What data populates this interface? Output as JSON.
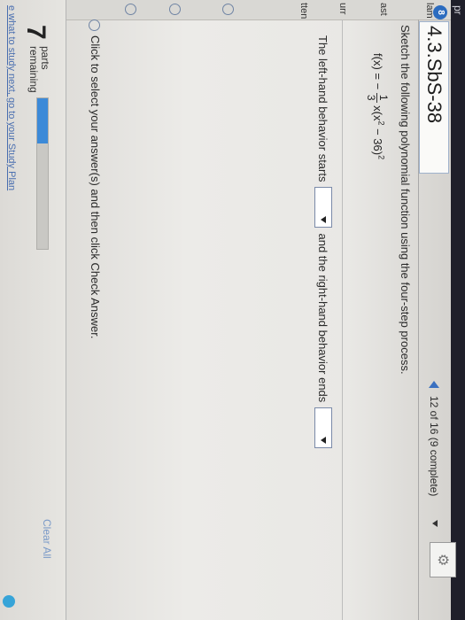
{
  "header": {
    "top_strip_label": "pr",
    "badge": "8",
    "title": "4.3.SbS-38",
    "progress": "12 of 16 (9 complete)"
  },
  "sidebar": {
    "items": [
      "lam",
      "ast",
      "urr",
      "tten"
    ]
  },
  "question": {
    "instruction": "Sketch the following polynomial function using the four-step process.",
    "formula_lhs": "f(x) = −",
    "formula_num": "1",
    "formula_den": "3",
    "formula_rest": "x(x",
    "formula_exp1": "2",
    "formula_tail": " − 36)",
    "formula_exp2": "2",
    "left_behavior_text": "The left-hand behavior starts",
    "right_behavior_text": "and the right-hand behavior ends",
    "left_select_value": "",
    "right_select_value": ""
  },
  "footer": {
    "click_instruction": "Click to select your answer(s) and then click Check Answer.",
    "parts_count": "7",
    "parts_line1": "parts",
    "parts_line2": "remaining",
    "parts_progress_fraction": 0.3,
    "clear_all_label": "Clear All",
    "study_plan_link": "e what to study next, go to your Study Plan"
  },
  "icons": {
    "settings": "gear-icon",
    "prev": "triangle-left-icon",
    "next": "chevron-down-icon"
  },
  "colors": {
    "accent_blue": "#3c8ad8",
    "link_blue": "#4a6fb0"
  }
}
